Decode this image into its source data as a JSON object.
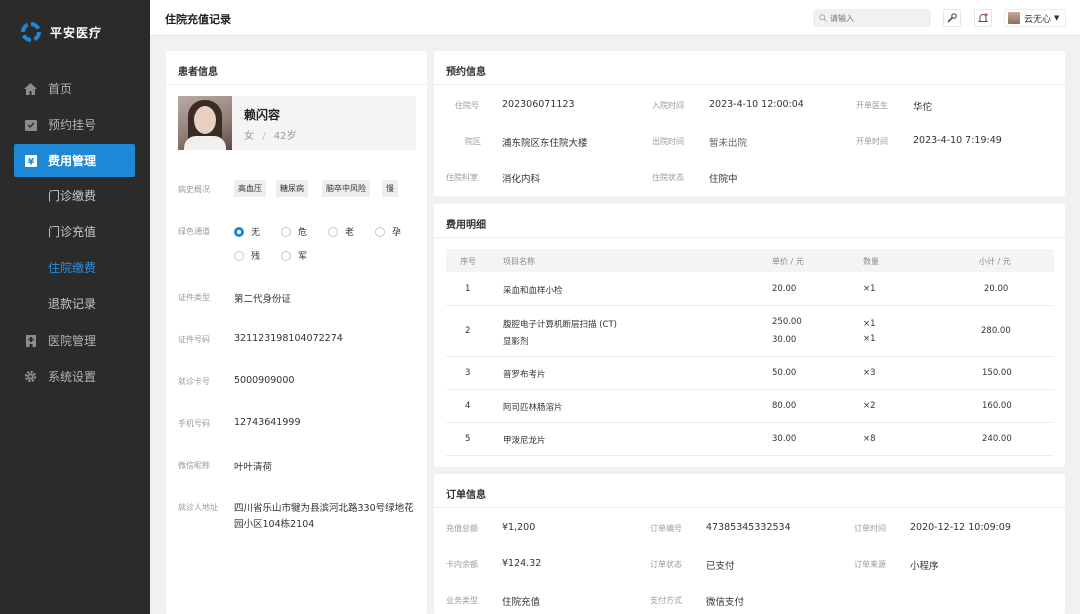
{
  "brand": {
    "name": "平安医疗",
    "accent": "#1d89d6"
  },
  "sidebar": {
    "items": [
      {
        "label": "首页",
        "icon": "home-icon"
      },
      {
        "label": "预约挂号",
        "icon": "appointment-icon"
      },
      {
        "label": "费用管理",
        "icon": "billing-icon"
      },
      {
        "label": "医院管理",
        "icon": "hospital-icon"
      },
      {
        "label": "系统设置",
        "icon": "gear-icon"
      }
    ],
    "sub_items": [
      {
        "label": "门诊缴费"
      },
      {
        "label": "门诊充值"
      },
      {
        "label": "住院缴费"
      },
      {
        "label": "退款记录"
      }
    ]
  },
  "header": {
    "title": "住院充值记录",
    "search_placeholder": "请输入",
    "user_name": "云无心"
  },
  "patient": {
    "section_title": "患者信息",
    "name": "赖闪容",
    "gender": "女",
    "sep": "/",
    "age": "42岁",
    "history_label": "病史概况",
    "history_tags": [
      "高血压",
      "糖尿病",
      "脑卒中风险",
      "慢"
    ],
    "green_label": "绿色通道",
    "green_options": [
      "无",
      "危",
      "老",
      "孕",
      "残",
      "军"
    ],
    "green_selected": "无",
    "fields": [
      {
        "label": "证件类型",
        "value": "第二代身份证"
      },
      {
        "label": "证件号码",
        "value": "321123198104072274"
      },
      {
        "label": "就诊卡号",
        "value": "5000909000"
      },
      {
        "label": "手机号码",
        "value": "12743641999"
      },
      {
        "label": "微信昵称",
        "value": "叶叶清荷"
      },
      {
        "label": "就诊人地址",
        "value": "四川省乐山市犍为县滨河北路330号绿地花园小区104栋2104"
      }
    ]
  },
  "appointment": {
    "section_title": "预约信息",
    "fields": [
      {
        "label": "住院号",
        "value": "202306071123"
      },
      {
        "label": "入院时间",
        "value": "2023-4-10 12:00:04"
      },
      {
        "label": "开单医生",
        "value": "华佗"
      },
      {
        "label": "院区",
        "value": "浦东院区东住院大楼"
      },
      {
        "label": "出院时间",
        "value": "暂未出院"
      },
      {
        "label": "开单时间",
        "value": "2023-4-10 7:19:49"
      },
      {
        "label": "住院科室",
        "value": "消化内科"
      },
      {
        "label": "住院状态",
        "value": "住院中"
      }
    ]
  },
  "fees": {
    "section_title": "费用明细",
    "columns": [
      "序号",
      "项目名称",
      "单价 / 元",
      "数量",
      "小计 / 元"
    ],
    "rows": [
      {
        "no": "1",
        "names": [
          "采血和血样小检"
        ],
        "prices": [
          "20.00"
        ],
        "qtys": [
          "×1"
        ],
        "subtotal": "20.00"
      },
      {
        "no": "2",
        "names": [
          "腹腔电子计算机断层扫描 (CT)",
          "显影剂"
        ],
        "prices": [
          "250.00",
          "30.00"
        ],
        "qtys": [
          "×1",
          "×1"
        ],
        "subtotal": "280.00"
      },
      {
        "no": "3",
        "names": [
          "普罗布考片"
        ],
        "prices": [
          "50.00"
        ],
        "qtys": [
          "×3"
        ],
        "subtotal": "150.00"
      },
      {
        "no": "4",
        "names": [
          "阿司匹林肠溶片"
        ],
        "prices": [
          "80.00"
        ],
        "qtys": [
          "×2"
        ],
        "subtotal": "160.00"
      },
      {
        "no": "5",
        "names": [
          "甲泼尼龙片"
        ],
        "prices": [
          "30.00"
        ],
        "qtys": [
          "×8"
        ],
        "subtotal": "240.00"
      }
    ]
  },
  "order": {
    "section_title": "订单信息",
    "fields": [
      {
        "label": "充值总额",
        "value": "¥1,200"
      },
      {
        "label": "订单编号",
        "value": "47385345332534"
      },
      {
        "label": "订单时间",
        "value": "2020-12-12 10:09:09"
      },
      {
        "label": "卡内余额",
        "value": "¥124.32"
      },
      {
        "label": "订单状态",
        "value": "已支付"
      },
      {
        "label": "订单来源",
        "value": "小程序"
      },
      {
        "label": "业务类型",
        "value": "住院充值"
      },
      {
        "label": "支付方式",
        "value": "微信支付"
      }
    ]
  }
}
